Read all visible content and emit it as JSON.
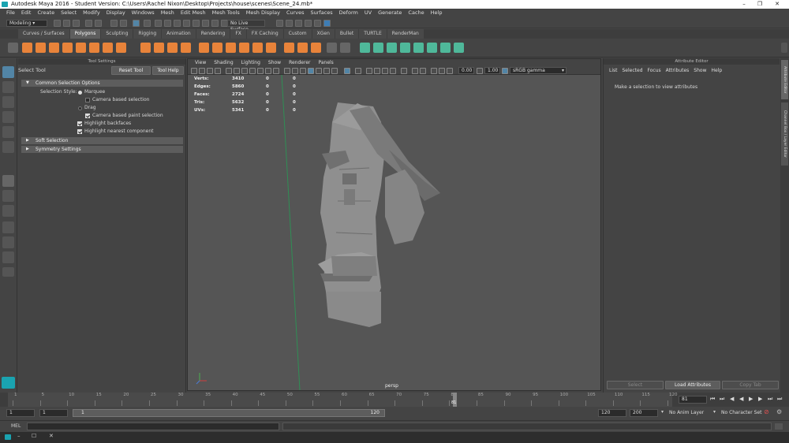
{
  "window": {
    "title": "Autodesk Maya 2016 - Student Version: C:\\Users\\Rachel Nixon\\Desktop\\Projects\\house\\scenes\\Scene_24.mb*",
    "controls": [
      "–",
      "❐",
      "✕"
    ]
  },
  "menubar": [
    "File",
    "Edit",
    "Create",
    "Select",
    "Modify",
    "Display",
    "Windows",
    "Mesh",
    "Edit Mesh",
    "Mesh Tools",
    "Mesh Display",
    "Curves",
    "Surfaces",
    "Deform",
    "UV",
    "Generate",
    "Cache",
    "Help"
  ],
  "statusline": {
    "menu_set": "Modeling",
    "live_surface": "No Live Surface"
  },
  "shelf": {
    "tabs": [
      "Curves / Surfaces",
      "Polygons",
      "Sculpting",
      "Rigging",
      "Animation",
      "Rendering",
      "FX",
      "FX Caching",
      "Custom",
      "XGen",
      "Bullet",
      "TURTLE",
      "RenderMan"
    ],
    "active_tab": "Polygons"
  },
  "tool_settings": {
    "panel_title": "Tool Settings",
    "tool_name": "Select Tool",
    "reset_label": "Reset Tool",
    "help_label": "Tool Help",
    "common_frame": "Common Selection Options",
    "selection_style_label": "Selection Style:",
    "marquee": "Marquee",
    "camera_based_selection": "Camera based selection",
    "drag": "Drag",
    "camera_based_paint": "Camera based paint selection",
    "highlight_backfaces": "Highlight backfaces",
    "highlight_nearest": "Highlight nearest component",
    "soft_selection": "Soft Selection",
    "symmetry_settings": "Symmetry Settings"
  },
  "viewport": {
    "menu": [
      "View",
      "Shading",
      "Lighting",
      "Show",
      "Renderer",
      "Panels"
    ],
    "gamma_near": "0.00",
    "gamma_exposure": "1.00",
    "color_space": "sRGB gamma",
    "camera_label": "persp",
    "hud": [
      {
        "label": "Verts:",
        "v1": "3410",
        "v2": "0",
        "v3": "0"
      },
      {
        "label": "Edges:",
        "v1": "5860",
        "v2": "0",
        "v3": "0"
      },
      {
        "label": "Faces:",
        "v1": "2724",
        "v2": "0",
        "v3": "0"
      },
      {
        "label": "Tris:",
        "v1": "5632",
        "v2": "0",
        "v3": "0"
      },
      {
        "label": "UVs:",
        "v1": "5341",
        "v2": "0",
        "v3": "0"
      }
    ]
  },
  "attribute_editor": {
    "panel_title": "Attribute Editor",
    "menu": [
      "List",
      "Selected",
      "Focus",
      "Attributes",
      "Show",
      "Help"
    ],
    "message": "Make a selection to view attributes",
    "select_label": "Select",
    "load_label": "Load Attributes",
    "copy_label": "Copy Tab"
  },
  "side_tabs": [
    "Attribute Editor",
    "Channel Box / Layer Editor"
  ],
  "timeline": {
    "ticks": [
      "1",
      "5",
      "10",
      "15",
      "20",
      "25",
      "30",
      "35",
      "40",
      "45",
      "50",
      "55",
      "60",
      "65",
      "70",
      "75",
      "80",
      "85",
      "90",
      "95",
      "100",
      "105",
      "110",
      "115",
      "120"
    ],
    "current_frame_marker": "81",
    "current_frame": "81"
  },
  "range": {
    "start": "1",
    "playback_start": "1",
    "slider_start": "1",
    "slider_end": "120",
    "playback_end": "120",
    "end": "200",
    "anim_layer": "No Anim Layer",
    "char_set": "No Character Set"
  },
  "command_line": {
    "lang": "MEL"
  },
  "colors": {
    "accent": "#5285a6",
    "shelf_orange": "#e8833a",
    "shelf_green": "#4fb89a"
  }
}
